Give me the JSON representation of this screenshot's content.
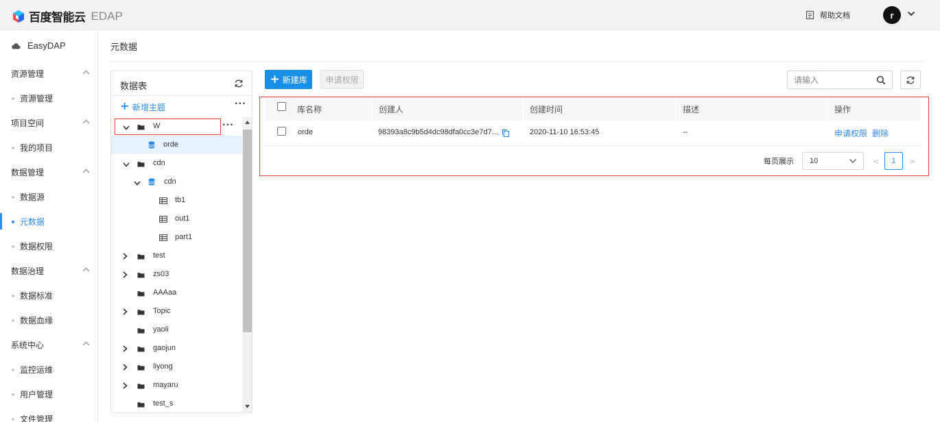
{
  "header": {
    "brand": "百度智能云",
    "product": "EDAP",
    "help_label": "帮助文档",
    "avatar_initial": "r"
  },
  "sidebar": {
    "brand": "EasyDAP",
    "groups": [
      {
        "label": "资源管理",
        "items": [
          "资源管理"
        ]
      },
      {
        "label": "项目空间",
        "items": [
          "我的项目"
        ]
      },
      {
        "label": "数据管理",
        "items": [
          "数据源",
          "元数据",
          "数据权限"
        ]
      },
      {
        "label": "数据治理",
        "items": [
          "数据标准",
          "数据血缘"
        ]
      },
      {
        "label": "系统中心",
        "items": [
          "监控运维",
          "用户管理",
          "文件管理"
        ]
      }
    ],
    "active_item": "元数据"
  },
  "page": {
    "title": "元数据"
  },
  "tree": {
    "title": "数据表",
    "add_label": "新增主题",
    "more": "···",
    "nodes": [
      {
        "name": "W",
        "level": 0,
        "type": "folder",
        "expanded": true
      },
      {
        "name": "orde",
        "level": 1,
        "type": "database",
        "selected": true
      },
      {
        "name": "cdn",
        "level": 0,
        "type": "folder",
        "expanded": true
      },
      {
        "name": "cdn",
        "level": 1,
        "type": "database",
        "expanded": true
      },
      {
        "name": "tb1",
        "level": 2,
        "type": "table"
      },
      {
        "name": "out1",
        "level": 2,
        "type": "table"
      },
      {
        "name": "part1",
        "level": 2,
        "type": "table"
      },
      {
        "name": "test",
        "level": 0,
        "type": "folder",
        "expanded": false
      },
      {
        "name": "zs03",
        "level": 0,
        "type": "folder",
        "expanded": false
      },
      {
        "name": "AAAaa",
        "level": 0,
        "type": "folder",
        "leaf": true
      },
      {
        "name": "Topic",
        "level": 0,
        "type": "folder",
        "expanded": false
      },
      {
        "name": "yaoli",
        "level": 0,
        "type": "folder",
        "leaf": true
      },
      {
        "name": "gaojun",
        "level": 0,
        "type": "folder",
        "expanded": false
      },
      {
        "name": "liyong",
        "level": 0,
        "type": "folder",
        "expanded": false
      },
      {
        "name": "mayaru",
        "level": 0,
        "type": "folder",
        "expanded": false
      },
      {
        "name": "test_s",
        "level": 0,
        "type": "folder",
        "leaf": true
      }
    ]
  },
  "toolbar": {
    "new_db_label": "新建库",
    "apply_perm_label": "申请权限",
    "search_placeholder": "请输入"
  },
  "table": {
    "columns": [
      "库名称",
      "创建人",
      "创建时间",
      "描述",
      "操作"
    ],
    "rows": [
      {
        "name": "orde",
        "creator": "98393a8c9b5d4dc98dfa0cc3e7d7...",
        "created": "2020-11-10 16:53:45",
        "desc": "--",
        "actions": [
          "申请权限",
          "删除"
        ]
      }
    ]
  },
  "pager": {
    "per_page_label": "每页展示",
    "per_page_value": "10",
    "prev": "<",
    "current": "1",
    "next": ">"
  },
  "colors": {
    "accent": "#1890e8",
    "link": "#2d8cf0",
    "highlight_border": "#e0413a",
    "selected_bg": "#e6f3fc"
  }
}
